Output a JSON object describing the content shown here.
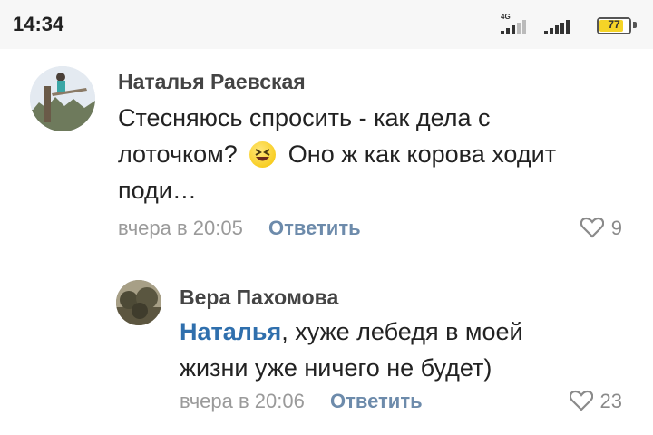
{
  "status_bar": {
    "time": "14:34",
    "network": "4G",
    "battery": "77",
    "battery_color": "#f5d427"
  },
  "comments": [
    {
      "author": "Наталья Раевская",
      "text_lines": [
        "Стесняюсь спросить - как дела с",
        "лоточком?",
        "Оно ж как корова ходит",
        "поди…"
      ],
      "emoji": "laughing-face-icon",
      "date": "вчера в 20:05",
      "reply_label": "Ответить",
      "likes": "9"
    },
    {
      "author": "Вера Пахомова",
      "mention": "Наталья",
      "text_line1_rest": ", хуже лебедя в моей",
      "text_line2": "жизни уже ничего не будет)",
      "date": "вчера в 20:06",
      "reply_label": "Ответить",
      "likes": "23"
    }
  ],
  "colors": {
    "mention": "#2f6fad",
    "reply": "#6d8bab",
    "meta": "#9a9a9a"
  }
}
